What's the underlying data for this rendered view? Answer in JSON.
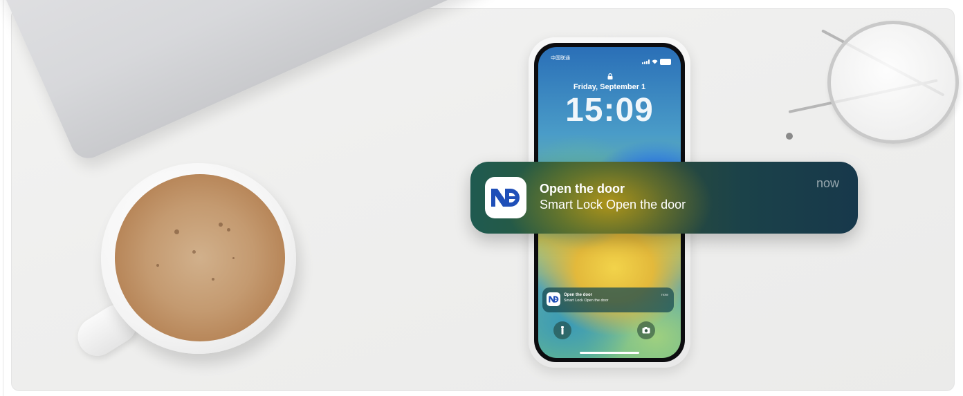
{
  "phone_screen": {
    "carrier": "中国联通",
    "date": "Friday, September 1",
    "time": "15:09"
  },
  "mini_notification": {
    "app_icon": "nd-app-icon",
    "title": "Open the door",
    "body": "Smart Lock Open the door",
    "time": "now"
  },
  "notification": {
    "app_icon": "nd-app-icon",
    "title": "Open the door",
    "body": "Smart Lock Open the door",
    "time": "now"
  },
  "icons": {
    "lock": "lock-icon",
    "flashlight": "flashlight-icon",
    "camera": "camera-icon"
  },
  "colors": {
    "brand_blue": "#1f4fb8",
    "notification_text": "#ffffff"
  }
}
